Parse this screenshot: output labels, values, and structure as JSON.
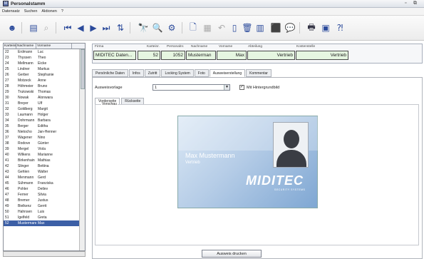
{
  "window": {
    "title": "Personalstamm"
  },
  "menu": [
    "Datensatz",
    "Suchen",
    "Aktionen",
    "?"
  ],
  "list": {
    "columns": [
      "Karteinr.",
      "Nachname",
      "Vorname"
    ],
    "rows": [
      [
        "22",
        "Erdmann",
        "Luc"
      ],
      [
        "23",
        "Thyssen",
        "Theo"
      ],
      [
        "24",
        "Mellmann",
        "Eicke"
      ],
      [
        "25",
        "Lindner",
        "Markus"
      ],
      [
        "26",
        "Gerber",
        "Stephanie"
      ],
      [
        "27",
        "Motzeck",
        "Anne"
      ],
      [
        "28",
        "Höhmeier",
        "Bruno"
      ],
      [
        "29",
        "Trukowski",
        "Thomas"
      ],
      [
        "30",
        "Nowak",
        "Alonwara"
      ],
      [
        "31",
        "Breyer",
        "Ulf"
      ],
      [
        "32",
        "Goldberg",
        "Margit"
      ],
      [
        "33",
        "Laumann",
        "Holger"
      ],
      [
        "34",
        "Dohrmann",
        "Barbara"
      ],
      [
        "35",
        "Berger",
        "Editha"
      ],
      [
        "36",
        "Nietocho",
        "Jan-Henner"
      ],
      [
        "37",
        "Wagener",
        "Nino"
      ],
      [
        "38",
        "Rodove",
        "Günter"
      ],
      [
        "39",
        "Mergel",
        "Viola"
      ],
      [
        "40",
        "Wilkens",
        "Marianne"
      ],
      [
        "41",
        "Birkenhain",
        "Mathias"
      ],
      [
        "42",
        "Slinger",
        "Bettina"
      ],
      [
        "43",
        "Gehlen",
        "Walter"
      ],
      [
        "44",
        "Menmann",
        "Gerd"
      ],
      [
        "45",
        "Sühmann",
        "Franziska"
      ],
      [
        "46",
        "Pohler",
        "Detlev"
      ],
      [
        "47",
        "Ferner",
        "Silvia"
      ],
      [
        "48",
        "Bremer",
        "Justus"
      ],
      [
        "49",
        "Bielkenz",
        "Gerrit"
      ],
      [
        "50",
        "Hahnsen",
        "Luis"
      ],
      [
        "51",
        "Igelfeld",
        "Greta"
      ],
      [
        "52",
        "Mustermann",
        "Max"
      ]
    ],
    "selected_index": 30
  },
  "header": {
    "labels": {
      "firma": "Firma",
      "karteinr": "Karteinr.",
      "personalnr": "Personalnr.",
      "nachname": "Nachname",
      "vorname": "Vorname",
      "abteilung": "Abteilung",
      "kostenstelle": "Kostenstelle"
    },
    "values": {
      "firma": "MIDITEC Daten...",
      "karteinr": "52",
      "personalnr": "1052",
      "nachname": "Musterman",
      "vorname": "Max",
      "abteilung": "Vertrieb",
      "kostenstelle": "Vertrieb"
    }
  },
  "tabs": [
    "Persönliche Daten",
    "Infos",
    "Zutritt",
    "Locking System",
    "Foto",
    "Ausweiserstellung",
    "Kommentar"
  ],
  "active_tab_index": 5,
  "form": {
    "vorlage_label": "Ausweisvorlage",
    "vorlage_value": "1",
    "checkbox_label": "Mit Hintergrundbild",
    "checkbox_checked": true,
    "subtabs": [
      "Vorderseite",
      "Rückseite"
    ],
    "preview_label": "Vorschau"
  },
  "card": {
    "name": "Max Mustermann",
    "department": "Vertrieb",
    "logo": "MIDITEC",
    "logo_sub": "SECURITY SYSTEMS"
  },
  "print_button": "Ausweis drucken",
  "colors": {
    "selection": "#3c5fa6",
    "field_bg": "#e6f6e1",
    "accent": "#2b4a9b"
  }
}
